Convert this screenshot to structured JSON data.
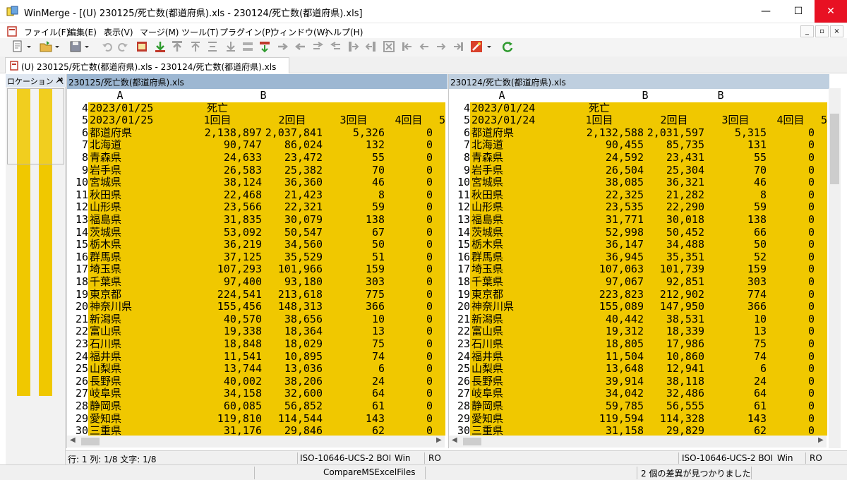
{
  "window": {
    "title": "WinMerge - [(U) 230125/死亡数(都道府県).xls - 230124/死亡数(都道府県).xls]",
    "minimize": "—",
    "maximize": "☐",
    "close": "✕"
  },
  "menu": [
    "ファイル(F)",
    "編集(E)",
    "表示(V)",
    "マージ(M)",
    "ツール(T)",
    "プラグイン(P)",
    "ウィンドウ(W)",
    "ヘルプ(H)"
  ],
  "mdi_buttons": [
    "_",
    "▫",
    "×"
  ],
  "tab": {
    "label": "(U) 230125/死亡数(都道府県).xls - 230124/死亡数(都道府県).xls"
  },
  "location_pane": {
    "title": "ロケーション ペ",
    "close": "×"
  },
  "colors": {
    "diff_row": "#f0c800",
    "header_left": "#9db7d2",
    "header_right": "#bfcfdf",
    "title_close": "#e81123"
  },
  "columns": {
    "a": "A",
    "b": "B",
    "five": "5"
  },
  "left": {
    "title": "230125/死亡数(都道府県).xls",
    "rows": [
      {
        "n": "4",
        "a": "2023/01/25",
        "b1": "死亡",
        "b2": "",
        "b3": "",
        "b4": ""
      },
      {
        "n": "5",
        "a": "2023/01/25",
        "b1": "1回目",
        "b2": "2回目",
        "b3": "3回目",
        "b4": "4回目"
      },
      {
        "n": "6",
        "a": "都道府県",
        "b1": "2,138,897",
        "b2": "2,037,841",
        "b3": "5,326",
        "b4": "0"
      },
      {
        "n": "7",
        "a": "北海道",
        "b1": "90,747",
        "b2": "86,024",
        "b3": "132",
        "b4": "0"
      },
      {
        "n": "8",
        "a": "青森県",
        "b1": "24,633",
        "b2": "23,472",
        "b3": "55",
        "b4": "0"
      },
      {
        "n": "9",
        "a": "岩手県",
        "b1": "26,583",
        "b2": "25,382",
        "b3": "70",
        "b4": "0"
      },
      {
        "n": "10",
        "a": "宮城県",
        "b1": "38,124",
        "b2": "36,360",
        "b3": "46",
        "b4": "0"
      },
      {
        "n": "11",
        "a": "秋田県",
        "b1": "22,468",
        "b2": "21,423",
        "b3": "8",
        "b4": "0"
      },
      {
        "n": "12",
        "a": "山形県",
        "b1": "23,566",
        "b2": "22,321",
        "b3": "59",
        "b4": "0"
      },
      {
        "n": "13",
        "a": "福島県",
        "b1": "31,835",
        "b2": "30,079",
        "b3": "138",
        "b4": "0"
      },
      {
        "n": "14",
        "a": "茨城県",
        "b1": "53,092",
        "b2": "50,547",
        "b3": "67",
        "b4": "0"
      },
      {
        "n": "15",
        "a": "栃木県",
        "b1": "36,219",
        "b2": "34,560",
        "b3": "50",
        "b4": "0"
      },
      {
        "n": "16",
        "a": "群馬県",
        "b1": "37,125",
        "b2": "35,529",
        "b3": "51",
        "b4": "0"
      },
      {
        "n": "17",
        "a": "埼玉県",
        "b1": "107,293",
        "b2": "101,966",
        "b3": "159",
        "b4": "0"
      },
      {
        "n": "18",
        "a": "千葉県",
        "b1": "97,400",
        "b2": "93,180",
        "b3": "303",
        "b4": "0"
      },
      {
        "n": "19",
        "a": "東京都",
        "b1": "224,541",
        "b2": "213,618",
        "b3": "775",
        "b4": "0"
      },
      {
        "n": "20",
        "a": "神奈川県",
        "b1": "155,456",
        "b2": "148,313",
        "b3": "366",
        "b4": "0"
      },
      {
        "n": "21",
        "a": "新潟県",
        "b1": "40,570",
        "b2": "38,656",
        "b3": "10",
        "b4": "0"
      },
      {
        "n": "22",
        "a": "富山県",
        "b1": "19,338",
        "b2": "18,364",
        "b3": "13",
        "b4": "0"
      },
      {
        "n": "23",
        "a": "石川県",
        "b1": "18,848",
        "b2": "18,029",
        "b3": "75",
        "b4": "0"
      },
      {
        "n": "24",
        "a": "福井県",
        "b1": "11,541",
        "b2": "10,895",
        "b3": "74",
        "b4": "0"
      },
      {
        "n": "25",
        "a": "山梨県",
        "b1": "13,744",
        "b2": "13,036",
        "b3": "6",
        "b4": "0"
      },
      {
        "n": "26",
        "a": "長野県",
        "b1": "40,002",
        "b2": "38,206",
        "b3": "24",
        "b4": "0"
      },
      {
        "n": "27",
        "a": "岐阜県",
        "b1": "34,158",
        "b2": "32,600",
        "b3": "64",
        "b4": "0"
      },
      {
        "n": "28",
        "a": "静岡県",
        "b1": "60,085",
        "b2": "56,852",
        "b3": "61",
        "b4": "0"
      },
      {
        "n": "29",
        "a": "愛知県",
        "b1": "119,810",
        "b2": "114,544",
        "b3": "143",
        "b4": "0"
      },
      {
        "n": "30",
        "a": "三重県",
        "b1": "31,176",
        "b2": "29,846",
        "b3": "62",
        "b4": "0"
      }
    ]
  },
  "right": {
    "title": "230124/死亡数(都道府県).xls",
    "rows": [
      {
        "n": "4",
        "a": "2023/01/24",
        "b1": "死亡",
        "b2": "",
        "b3": "",
        "b4": ""
      },
      {
        "n": "5",
        "a": "2023/01/24",
        "b1": "1回目",
        "b2": "2回目",
        "b3": "3回目",
        "b4": "4回目"
      },
      {
        "n": "6",
        "a": "都道府県",
        "b1": "2,132,588",
        "b2": "2,031,597",
        "b3": "5,315",
        "b4": "0"
      },
      {
        "n": "7",
        "a": "北海道",
        "b1": "90,455",
        "b2": "85,735",
        "b3": "131",
        "b4": "0"
      },
      {
        "n": "8",
        "a": "青森県",
        "b1": "24,592",
        "b2": "23,431",
        "b3": "55",
        "b4": "0"
      },
      {
        "n": "9",
        "a": "岩手県",
        "b1": "26,504",
        "b2": "25,304",
        "b3": "70",
        "b4": "0"
      },
      {
        "n": "10",
        "a": "宮城県",
        "b1": "38,085",
        "b2": "36,321",
        "b3": "46",
        "b4": "0"
      },
      {
        "n": "11",
        "a": "秋田県",
        "b1": "22,325",
        "b2": "21,282",
        "b3": "8",
        "b4": "0"
      },
      {
        "n": "12",
        "a": "山形県",
        "b1": "23,535",
        "b2": "22,290",
        "b3": "59",
        "b4": "0"
      },
      {
        "n": "13",
        "a": "福島県",
        "b1": "31,771",
        "b2": "30,018",
        "b3": "138",
        "b4": "0"
      },
      {
        "n": "14",
        "a": "茨城県",
        "b1": "52,998",
        "b2": "50,452",
        "b3": "66",
        "b4": "0"
      },
      {
        "n": "15",
        "a": "栃木県",
        "b1": "36,147",
        "b2": "34,488",
        "b3": "50",
        "b4": "0"
      },
      {
        "n": "16",
        "a": "群馬県",
        "b1": "36,945",
        "b2": "35,351",
        "b3": "52",
        "b4": "0"
      },
      {
        "n": "17",
        "a": "埼玉県",
        "b1": "107,063",
        "b2": "101,739",
        "b3": "159",
        "b4": "0"
      },
      {
        "n": "18",
        "a": "千葉県",
        "b1": "97,067",
        "b2": "92,851",
        "b3": "303",
        "b4": "0"
      },
      {
        "n": "19",
        "a": "東京都",
        "b1": "223,823",
        "b2": "212,902",
        "b3": "774",
        "b4": "0"
      },
      {
        "n": "20",
        "a": "神奈川県",
        "b1": "155,089",
        "b2": "147,950",
        "b3": "366",
        "b4": "0"
      },
      {
        "n": "21",
        "a": "新潟県",
        "b1": "40,442",
        "b2": "38,531",
        "b3": "10",
        "b4": "0"
      },
      {
        "n": "22",
        "a": "富山県",
        "b1": "19,312",
        "b2": "18,339",
        "b3": "13",
        "b4": "0"
      },
      {
        "n": "23",
        "a": "石川県",
        "b1": "18,805",
        "b2": "17,986",
        "b3": "75",
        "b4": "0"
      },
      {
        "n": "24",
        "a": "福井県",
        "b1": "11,504",
        "b2": "10,860",
        "b3": "74",
        "b4": "0"
      },
      {
        "n": "25",
        "a": "山梨県",
        "b1": "13,648",
        "b2": "12,941",
        "b3": "6",
        "b4": "0"
      },
      {
        "n": "26",
        "a": "長野県",
        "b1": "39,914",
        "b2": "38,118",
        "b3": "24",
        "b4": "0"
      },
      {
        "n": "27",
        "a": "岐阜県",
        "b1": "34,042",
        "b2": "32,486",
        "b3": "64",
        "b4": "0"
      },
      {
        "n": "28",
        "a": "静岡県",
        "b1": "59,785",
        "b2": "56,555",
        "b3": "61",
        "b4": "0"
      },
      {
        "n": "29",
        "a": "愛知県",
        "b1": "119,594",
        "b2": "114,328",
        "b3": "143",
        "b4": "0"
      },
      {
        "n": "30",
        "a": "三重県",
        "b1": "31,158",
        "b2": "29,829",
        "b3": "62",
        "b4": "0"
      }
    ]
  },
  "status": {
    "left_pos": "行: 1  列: 1/8  文字: 1/8",
    "left_enc": "ISO-10646-UCS-2 BOM",
    "left_eol": "Win",
    "left_ro": "RO",
    "right_enc": "ISO-10646-UCS-2 BOM",
    "right_eol": "Win",
    "right_ro": "RO"
  },
  "bottom": {
    "plugin": "CompareMSExcelFiles",
    "diff_count": "2 個の差異が見つかりました"
  }
}
